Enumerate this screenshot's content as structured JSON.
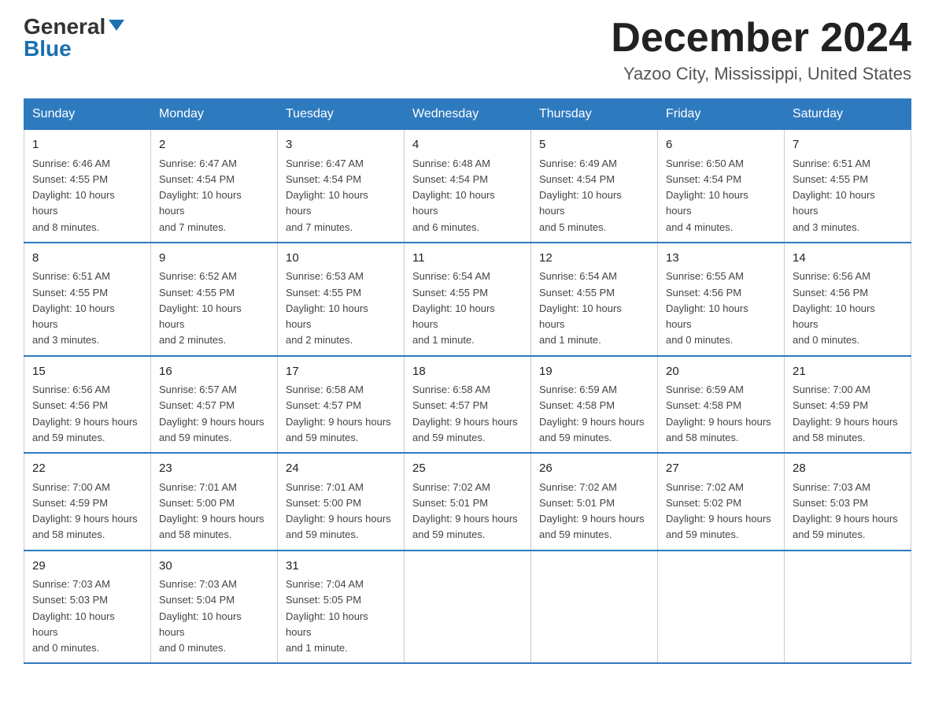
{
  "header": {
    "logo_general": "General",
    "logo_blue": "Blue",
    "month_year": "December 2024",
    "location": "Yazoo City, Mississippi, United States"
  },
  "weekdays": [
    "Sunday",
    "Monday",
    "Tuesday",
    "Wednesday",
    "Thursday",
    "Friday",
    "Saturday"
  ],
  "weeks": [
    [
      {
        "day": "1",
        "sunrise": "6:46 AM",
        "sunset": "4:55 PM",
        "daylight": "10 hours and 8 minutes."
      },
      {
        "day": "2",
        "sunrise": "6:47 AM",
        "sunset": "4:54 PM",
        "daylight": "10 hours and 7 minutes."
      },
      {
        "day": "3",
        "sunrise": "6:47 AM",
        "sunset": "4:54 PM",
        "daylight": "10 hours and 7 minutes."
      },
      {
        "day": "4",
        "sunrise": "6:48 AM",
        "sunset": "4:54 PM",
        "daylight": "10 hours and 6 minutes."
      },
      {
        "day": "5",
        "sunrise": "6:49 AM",
        "sunset": "4:54 PM",
        "daylight": "10 hours and 5 minutes."
      },
      {
        "day": "6",
        "sunrise": "6:50 AM",
        "sunset": "4:54 PM",
        "daylight": "10 hours and 4 minutes."
      },
      {
        "day": "7",
        "sunrise": "6:51 AM",
        "sunset": "4:55 PM",
        "daylight": "10 hours and 3 minutes."
      }
    ],
    [
      {
        "day": "8",
        "sunrise": "6:51 AM",
        "sunset": "4:55 PM",
        "daylight": "10 hours and 3 minutes."
      },
      {
        "day": "9",
        "sunrise": "6:52 AM",
        "sunset": "4:55 PM",
        "daylight": "10 hours and 2 minutes."
      },
      {
        "day": "10",
        "sunrise": "6:53 AM",
        "sunset": "4:55 PM",
        "daylight": "10 hours and 2 minutes."
      },
      {
        "day": "11",
        "sunrise": "6:54 AM",
        "sunset": "4:55 PM",
        "daylight": "10 hours and 1 minute."
      },
      {
        "day": "12",
        "sunrise": "6:54 AM",
        "sunset": "4:55 PM",
        "daylight": "10 hours and 1 minute."
      },
      {
        "day": "13",
        "sunrise": "6:55 AM",
        "sunset": "4:56 PM",
        "daylight": "10 hours and 0 minutes."
      },
      {
        "day": "14",
        "sunrise": "6:56 AM",
        "sunset": "4:56 PM",
        "daylight": "10 hours and 0 minutes."
      }
    ],
    [
      {
        "day": "15",
        "sunrise": "6:56 AM",
        "sunset": "4:56 PM",
        "daylight": "9 hours and 59 minutes."
      },
      {
        "day": "16",
        "sunrise": "6:57 AM",
        "sunset": "4:57 PM",
        "daylight": "9 hours and 59 minutes."
      },
      {
        "day": "17",
        "sunrise": "6:58 AM",
        "sunset": "4:57 PM",
        "daylight": "9 hours and 59 minutes."
      },
      {
        "day": "18",
        "sunrise": "6:58 AM",
        "sunset": "4:57 PM",
        "daylight": "9 hours and 59 minutes."
      },
      {
        "day": "19",
        "sunrise": "6:59 AM",
        "sunset": "4:58 PM",
        "daylight": "9 hours and 59 minutes."
      },
      {
        "day": "20",
        "sunrise": "6:59 AM",
        "sunset": "4:58 PM",
        "daylight": "9 hours and 58 minutes."
      },
      {
        "day": "21",
        "sunrise": "7:00 AM",
        "sunset": "4:59 PM",
        "daylight": "9 hours and 58 minutes."
      }
    ],
    [
      {
        "day": "22",
        "sunrise": "7:00 AM",
        "sunset": "4:59 PM",
        "daylight": "9 hours and 58 minutes."
      },
      {
        "day": "23",
        "sunrise": "7:01 AM",
        "sunset": "5:00 PM",
        "daylight": "9 hours and 58 minutes."
      },
      {
        "day": "24",
        "sunrise": "7:01 AM",
        "sunset": "5:00 PM",
        "daylight": "9 hours and 59 minutes."
      },
      {
        "day": "25",
        "sunrise": "7:02 AM",
        "sunset": "5:01 PM",
        "daylight": "9 hours and 59 minutes."
      },
      {
        "day": "26",
        "sunrise": "7:02 AM",
        "sunset": "5:01 PM",
        "daylight": "9 hours and 59 minutes."
      },
      {
        "day": "27",
        "sunrise": "7:02 AM",
        "sunset": "5:02 PM",
        "daylight": "9 hours and 59 minutes."
      },
      {
        "day": "28",
        "sunrise": "7:03 AM",
        "sunset": "5:03 PM",
        "daylight": "9 hours and 59 minutes."
      }
    ],
    [
      {
        "day": "29",
        "sunrise": "7:03 AM",
        "sunset": "5:03 PM",
        "daylight": "10 hours and 0 minutes."
      },
      {
        "day": "30",
        "sunrise": "7:03 AM",
        "sunset": "5:04 PM",
        "daylight": "10 hours and 0 minutes."
      },
      {
        "day": "31",
        "sunrise": "7:04 AM",
        "sunset": "5:05 PM",
        "daylight": "10 hours and 1 minute."
      },
      null,
      null,
      null,
      null
    ]
  ]
}
